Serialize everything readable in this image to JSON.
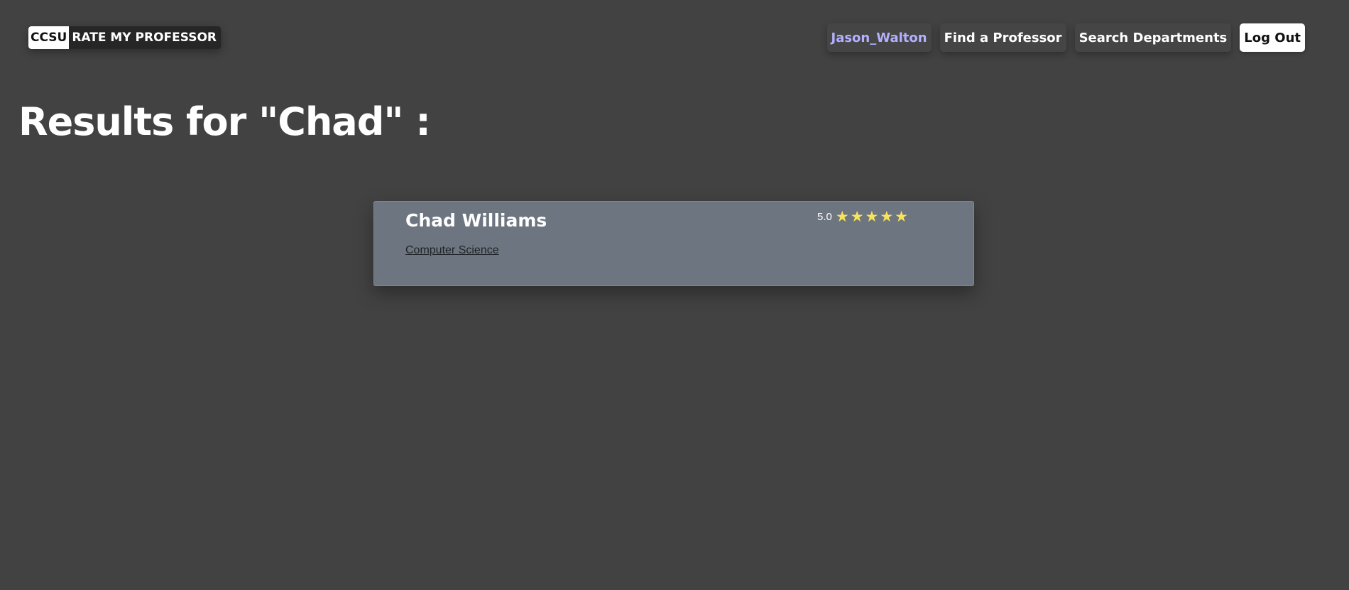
{
  "header": {
    "logo_mark": "CCSU",
    "logo_text": "RATE MY PROFESSOR",
    "nav": {
      "user": "Jason_Walton",
      "find_professor": "Find a Professor",
      "search_departments": "Search Departments",
      "logout": "Log Out"
    }
  },
  "page": {
    "title": "Results for \"Chad\" :"
  },
  "results": [
    {
      "name": "Chad Williams",
      "department": "Computer Science",
      "rating": "5.0",
      "stars": "★★★★★",
      "stars_count": 5
    }
  ],
  "colors": {
    "background": "#424242",
    "card": "#6d7580",
    "user_link": "#b3b1ff",
    "star": "#f8e35a"
  }
}
